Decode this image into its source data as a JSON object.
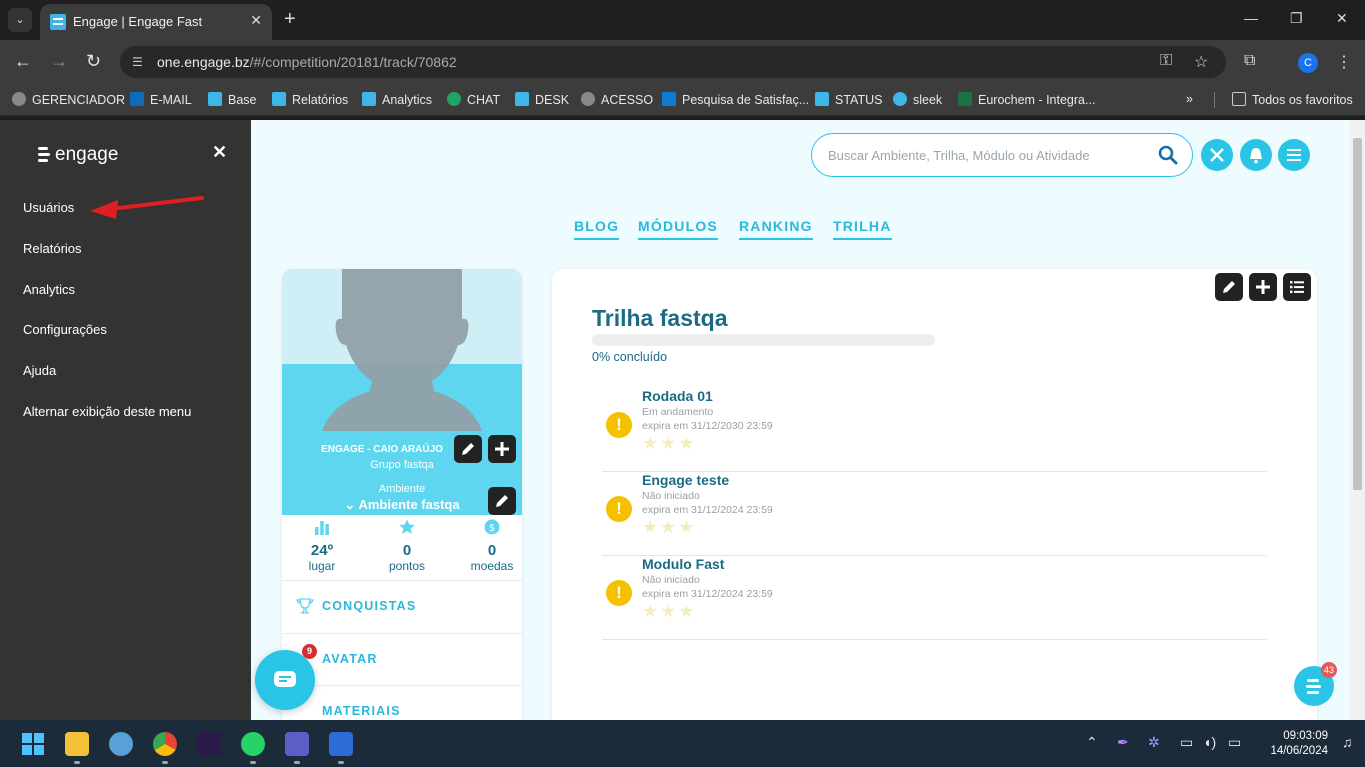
{
  "browser": {
    "tab_title": "Engage | Engage Fast",
    "url_host": "one.engage.bz",
    "url_path": "/#/competition/20181/track/70862",
    "profile_initial": "C",
    "bookmarks": [
      "GERENCIADOR",
      "E-MAIL",
      "Base",
      "Relatórios",
      "Analytics",
      "CHAT",
      "DESK",
      "ACESSO",
      "Pesquisa de Satisfaç...",
      "STATUS",
      "sleek",
      "Eurochem - Integra..."
    ],
    "all_bookmarks": "Todos os favoritos"
  },
  "sidebar": {
    "logo": "engage",
    "items": [
      "Usuários",
      "Relatórios",
      "Analytics",
      "Configurações",
      "Ajuda",
      "Alternar exibição deste menu"
    ]
  },
  "header": {
    "search_placeholder": "Buscar Ambiente, Trilha, Módulo ou Atividade",
    "nav": [
      "BLOG",
      "MÓDULOS",
      "RANKING",
      "TRILHA"
    ]
  },
  "profile": {
    "name": "ENGAGE - CAIO ARAÚJO",
    "group": "Grupo fastqa",
    "environment_label": "Ambiente",
    "environment": "Ambiente fastqa",
    "stats": [
      {
        "value": "24º",
        "label": "lugar"
      },
      {
        "value": "0",
        "label": "pontos"
      },
      {
        "value": "0",
        "label": "moedas"
      }
    ],
    "links": [
      "CONQUISTAS",
      "AVATAR",
      "MATERIAIS"
    ]
  },
  "track": {
    "title": "Trilha fastqa",
    "progress": 0,
    "progress_text": "0% concluído",
    "modules": [
      {
        "title": "Rodada 01",
        "status": "Em andamento",
        "expires": "expira em 31/12/2030 23:59"
      },
      {
        "title": "Engage teste",
        "status": "Não iniciado",
        "expires": "expira em 31/12/2024 23:59"
      },
      {
        "title": "Modulo Fast",
        "status": "Não iniciado",
        "expires": "expira em 31/12/2024 23:59"
      }
    ]
  },
  "widgets": {
    "chat_badge": "9",
    "engage_badge": "43"
  },
  "taskbar": {
    "time": "09:03:09",
    "date": "14/06/2024"
  },
  "colors": {
    "accent": "#29c4e6",
    "sidebar_bg": "#333333",
    "text_primary": "#1c6b84",
    "warning": "#f5c000"
  }
}
